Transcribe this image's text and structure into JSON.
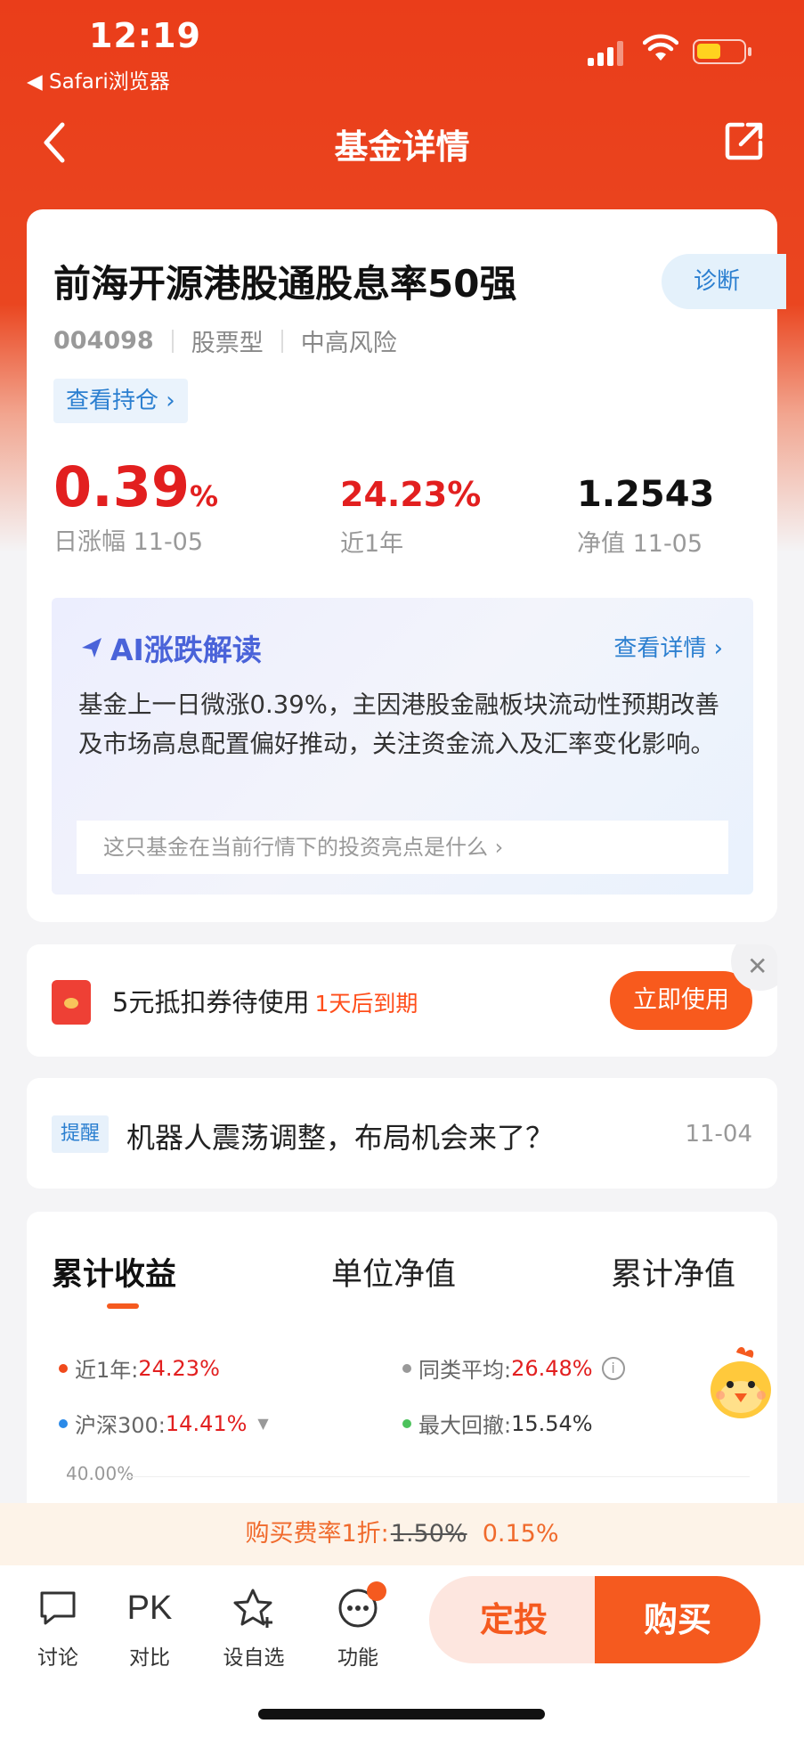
{
  "status_bar": {
    "time": "12:19",
    "back_app": "◀ Safari浏览器"
  },
  "nav": {
    "title": "基金详情"
  },
  "fund": {
    "name": "前海开源港股通股息率50强",
    "code": "004098",
    "type": "股票型",
    "risk": "中高风险",
    "diagnose_label": "诊断",
    "holdings_label": "查看持仓 ›",
    "daily_change_value": "0.39",
    "daily_change_unit": "%",
    "daily_change_label": "日涨幅 11-05",
    "one_year_value": "24.23%",
    "one_year_label": "近1年",
    "nav_value": "1.2543",
    "nav_label": "净值 11-05"
  },
  "ai": {
    "title": "AI涨跌解读",
    "more": "查看详情 ›",
    "text": "基金上一日微涨0.39%，主因港股金融板块流动性预期改善及市场高息配置偏好推动，关注资金流入及汇率变化影响。",
    "question": "这只基金在当前行情下的投资亮点是什么 ›"
  },
  "coupon": {
    "text": "5元抵扣券待使用",
    "expire": "1天后到期",
    "button": "立即使用",
    "close": "✕"
  },
  "reminder": {
    "tag": "提醒",
    "title": "机器人震荡调整，布局机会来了？",
    "date": "11-04"
  },
  "performance": {
    "tabs": [
      "累计收益",
      "单位净值",
      "累计净值"
    ],
    "legend": {
      "one_year_label": "近1年:",
      "one_year_value": "24.23%",
      "peer_label": "同类平均:",
      "peer_value": "26.48%",
      "index_label": "沪深300:",
      "index_value": "14.41%",
      "drawdown_label": "最大回撤:",
      "drawdown_value": "15.54%"
    },
    "axis_top": "40.00%",
    "colors": {
      "fund": "#f04a1c",
      "peer": "#999999",
      "index": "#2b8ae8",
      "drawdown": "#4cc25c"
    }
  },
  "fee": {
    "prefix": "购买费率1折:",
    "original": "1.50%",
    "discount": "0.15%"
  },
  "bottom_bar": {
    "discuss": "讨论",
    "compare_icon": "PK",
    "compare": "对比",
    "watchlist": "设自选",
    "functions": "功能",
    "sip": "定投",
    "buy": "购买"
  }
}
